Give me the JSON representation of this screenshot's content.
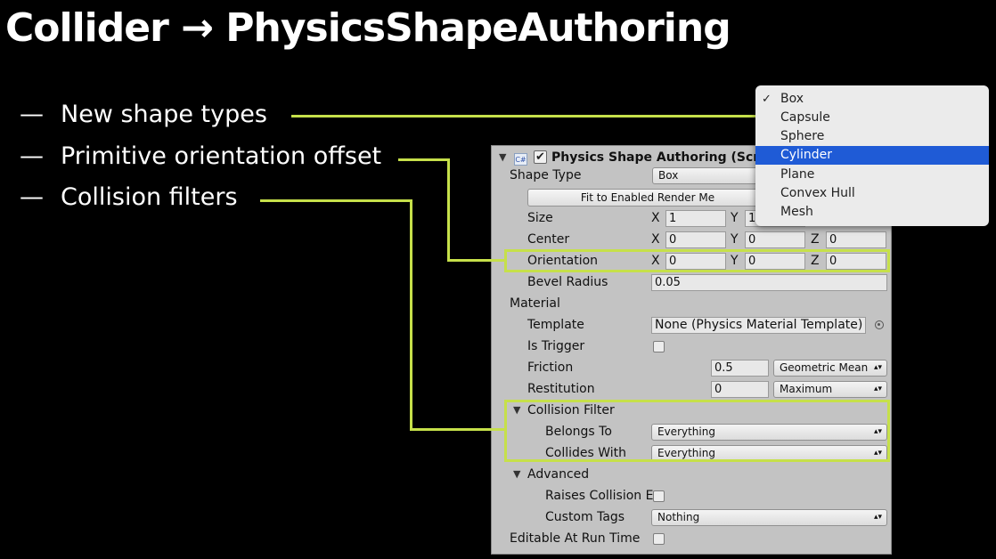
{
  "slide": {
    "title": "Collider → PhysicsShapeAuthoring",
    "bullet_dash": "—",
    "bullets": [
      "New shape types",
      "Primitive orientation offset",
      "Collision filters"
    ]
  },
  "colors": {
    "highlight": "#c6e04a",
    "selection": "#1f5bd6",
    "panel": "#c3c3c3"
  },
  "inspector": {
    "header": {
      "script_icon": "csharp-script-icon",
      "script_icon_text": "C#",
      "enabled": true,
      "title": "Physics Shape Authoring (Scrip"
    },
    "shape_type": {
      "label": "Shape Type",
      "value": "Box"
    },
    "fit_button": "Fit to Enabled Render Me",
    "size": {
      "label": "Size",
      "x": "1",
      "y": "1"
    },
    "center": {
      "label": "Center",
      "x": "0",
      "y": "0",
      "z": "0"
    },
    "orientation": {
      "label": "Orientation",
      "x": "0",
      "y": "0",
      "z": "0"
    },
    "axes": {
      "x": "X",
      "y": "Y",
      "z": "Z"
    },
    "bevel_radius": {
      "label": "Bevel Radius",
      "value": "0.05"
    },
    "material": {
      "label": "Material",
      "template": {
        "label": "Template",
        "value": "None (Physics Material Template)"
      },
      "is_trigger": {
        "label": "Is Trigger",
        "checked": false
      },
      "friction": {
        "label": "Friction",
        "value": "0.5",
        "mode": "Geometric Mean"
      },
      "restitution": {
        "label": "Restitution",
        "value": "0",
        "mode": "Maximum"
      }
    },
    "collision_filter": {
      "label": "Collision Filter",
      "belongs_to": {
        "label": "Belongs To",
        "value": "Everything"
      },
      "collides_with": {
        "label": "Collides With",
        "value": "Everything"
      }
    },
    "advanced": {
      "label": "Advanced",
      "raises_collision": {
        "label": "Raises Collision E",
        "checked": false
      },
      "custom_tags": {
        "label": "Custom Tags",
        "value": "Nothing"
      }
    },
    "editable_at_run_time": {
      "label": "Editable At Run Time",
      "checked": false
    }
  },
  "shape_dropdown": {
    "checkmark": "✓",
    "options": [
      "Box",
      "Capsule",
      "Sphere",
      "Cylinder",
      "Plane",
      "Convex Hull",
      "Mesh"
    ],
    "checked": "Box",
    "highlighted": "Cylinder"
  }
}
